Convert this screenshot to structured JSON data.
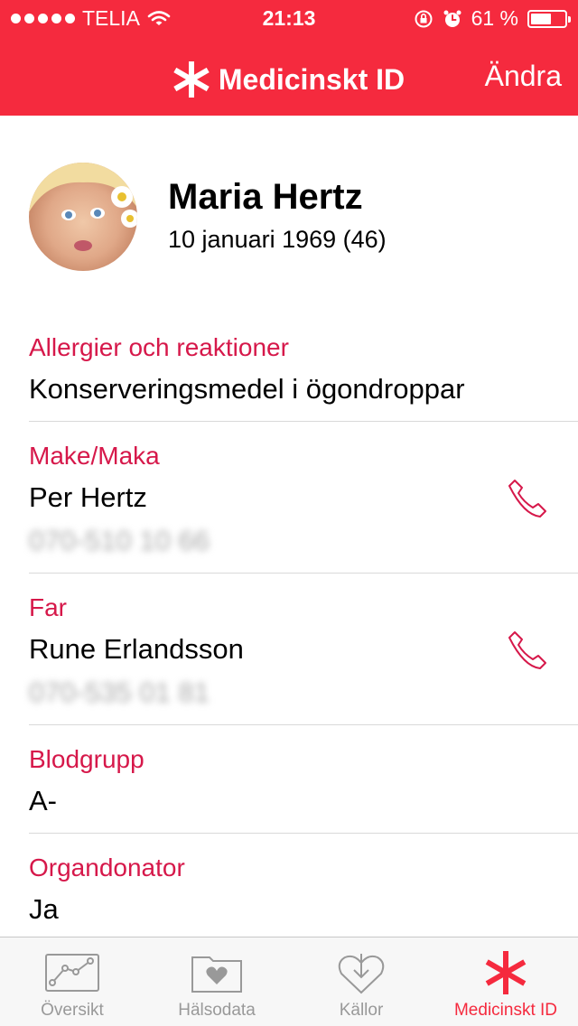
{
  "status_bar": {
    "carrier": "TELIA",
    "time": "21:13",
    "battery": "61 %",
    "battery_level": 0.61
  },
  "nav": {
    "title": "Medicinskt ID",
    "edit_label": "Ändra"
  },
  "profile": {
    "name": "Maria Hertz",
    "birthdate": "10 januari 1969 (46)"
  },
  "fields": {
    "allergies": {
      "label": "Allergier och reaktioner",
      "value": "Konserveringsmedel i ögondroppar"
    },
    "spouse": {
      "label": "Make/Maka",
      "name": "Per Hertz",
      "phone": "070-510 10 66"
    },
    "father": {
      "label": "Far",
      "name": "Rune Erlandsson",
      "phone": "070-535 01 81"
    },
    "blood_type": {
      "label": "Blodgrupp",
      "value": "A-"
    },
    "organ_donor": {
      "label": "Organdonator",
      "value": "Ja"
    }
  },
  "tabs": [
    {
      "label": "Översikt",
      "icon": "chart-icon"
    },
    {
      "label": "Hälsodata",
      "icon": "folder-heart-icon"
    },
    {
      "label": "Källor",
      "icon": "download-heart-icon"
    },
    {
      "label": "Medicinskt ID",
      "icon": "asterisk-icon"
    }
  ],
  "colors": {
    "accent": "#f52a3e",
    "label": "#d6184a"
  }
}
